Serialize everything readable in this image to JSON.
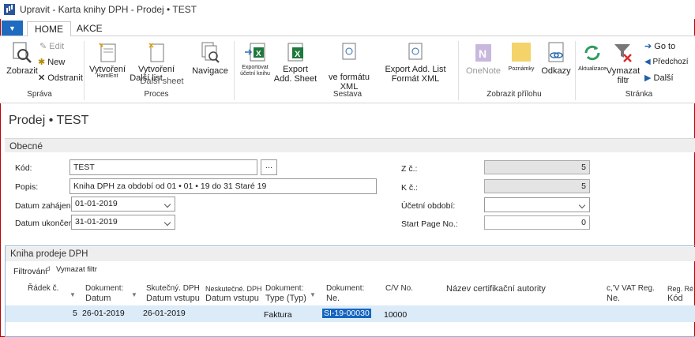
{
  "window": {
    "title": "Upravit - Karta knihy DPH -      Prodej • TEST"
  },
  "tabs": {
    "file": "▼",
    "home": "HOME",
    "akce": "AKCE"
  },
  "ribbon": {
    "zobrazit": "Zobrazit",
    "edit": "Edit",
    "new": "New",
    "odstranit": "Odstranit",
    "sprava": "Správa",
    "vytvoreni1": "Vytvoření",
    "vytvoreni2": "Vytvoření",
    "hamlet": "HamlEnt",
    "dalsi_list": "Další list",
    "dalsi_sheet": "Další sheet",
    "navigace": "Navigace",
    "proces": "Proces",
    "exportovat": "Exportovat",
    "ucetni_knihu": "účetní knihu",
    "export_add_sheet": "Export Add. Sheet",
    "ve_formatu_xml": "ve formátu XML",
    "export_add_list": "Export Add. List Formát XML",
    "sestava": "Sestava",
    "onenote": "OneNote",
    "poznamky": "Poznámky",
    "odkazy": "Odkazy",
    "zobrazit_prilohu": "Zobrazit přílohu",
    "aktualizace": "Aktualizace",
    "vymazat_filtr": "Vymazat filtr",
    "go_to": "Go to",
    "predchozi": "Předchozí",
    "dalsi": "Další",
    "stranka": "Stránka"
  },
  "page": {
    "title": "Prodej • TEST"
  },
  "general": {
    "header": "Obecné",
    "kod_label": "Kód:",
    "kod_value": "TEST",
    "ellipsis": "...",
    "popis_label": "Popis:",
    "popis_value": "Kniha DPH za období od 01 • 01 • 19 do 31 Staré 19",
    "datum_zahajeni_label": "Datum zahájení",
    "datum_zahajeni_value": "01-01-2019",
    "datum_ukonceni_label": "Datum ukončení",
    "datum_ukonceni_value": "31-01-2019",
    "z_c_label": "Z č.:",
    "z_c_value": "5",
    "k_c_label": "K č.:",
    "k_c_value": "5",
    "ucetni_obdobi_label": "Účetní období:",
    "ucetni_obdobi_value": "",
    "start_page_label": "Start Page No.:",
    "start_page_value": "0"
  },
  "subpage": {
    "header": "Kniha prodeje DPH",
    "filtrovani": "Filtrování",
    "vymazat_filtr": "Vymazat filtr",
    "columns": {
      "radek": "Řádek č.",
      "dokument_datum": [
        "Dokument:",
        "Datum"
      ],
      "skutecny": [
        "Skutečný. DPH",
        "Datum vstupu"
      ],
      "neskutecne": [
        "Neskutečné. DPH",
        "Datum vstupu"
      ],
      "dokument_typ": [
        "Dokument:",
        "Type (Typ)"
      ],
      "dokument_ne": [
        "Dokument:",
        "Ne."
      ],
      "cv_no": "C/V No.",
      "nazev": "Název certifikační autority",
      "vat_reg": [
        "c,'V VAT Reg.",
        "Ne."
      ],
      "reg": [
        "Reg. Ré",
        "Kód"
      ]
    },
    "rows": [
      {
        "radek": "5",
        "datum": "26-01-2019",
        "skutecny": "26-01-2019",
        "neskutecne": "",
        "typ": "Faktura",
        "ne": "SI-19-00030",
        "cv": "10000"
      }
    ]
  }
}
